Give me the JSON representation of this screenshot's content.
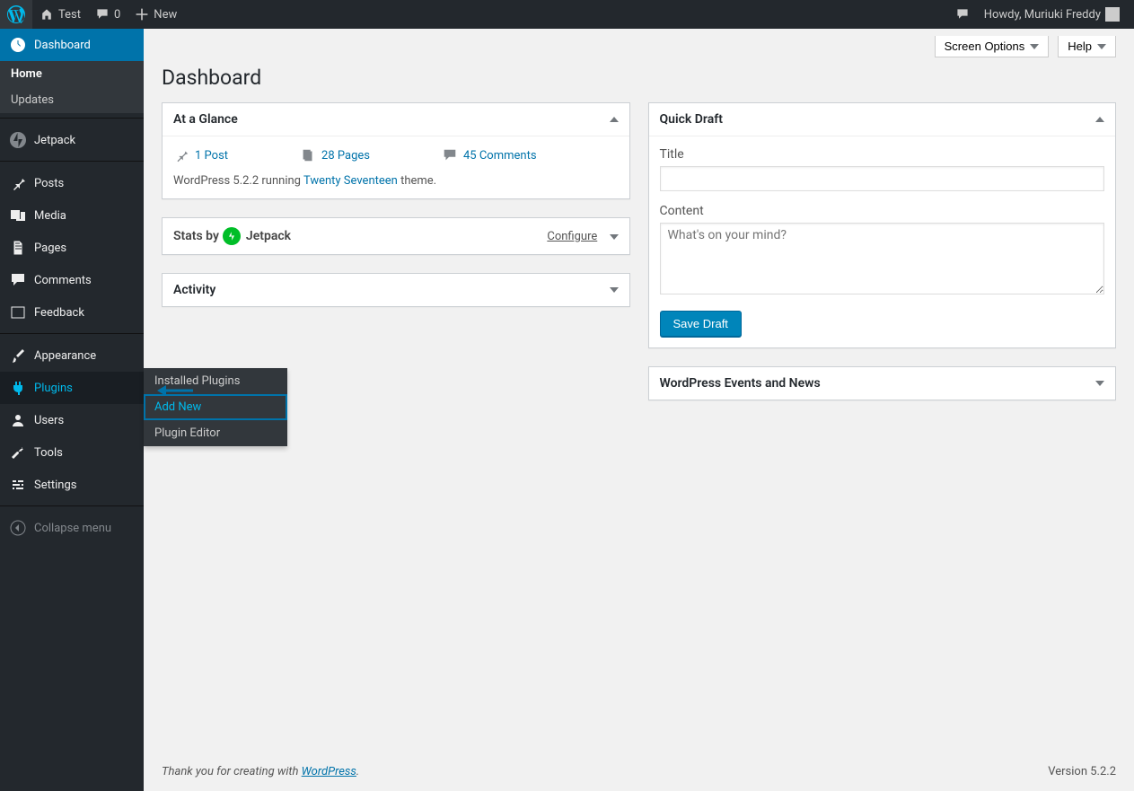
{
  "topbar": {
    "site_name": "Test",
    "comment_count": "0",
    "new_label": "New",
    "greeting": "Howdy, Muriuki Freddy"
  },
  "sidebar": {
    "dashboard": "Dashboard",
    "dashboard_sub": {
      "home": "Home",
      "updates": "Updates"
    },
    "jetpack": "Jetpack",
    "posts": "Posts",
    "media": "Media",
    "pages": "Pages",
    "comments": "Comments",
    "feedback": "Feedback",
    "appearance": "Appearance",
    "plugins": "Plugins",
    "plugins_fly": {
      "installed": "Installed Plugins",
      "add_new": "Add New",
      "editor": "Plugin Editor"
    },
    "users": "Users",
    "tools": "Tools",
    "settings": "Settings",
    "collapse": "Collapse menu"
  },
  "header": {
    "screen_options": "Screen Options",
    "help": "Help",
    "title": "Dashboard"
  },
  "glance": {
    "title": "At a Glance",
    "posts": "1 Post",
    "pages": "28 Pages",
    "comments": "45 Comments",
    "wp_version_prefix": "WordPress 5.2.2 running ",
    "theme": "Twenty Seventeen",
    "theme_suffix": " theme."
  },
  "stats": {
    "by": "Stats  by",
    "jetpack": "Jetpack",
    "configure": "Configure"
  },
  "activity": {
    "title": "Activity"
  },
  "quickdraft": {
    "title": "Quick Draft",
    "title_label": "Title",
    "content_label": "Content",
    "content_placeholder": "What's on your mind?",
    "save": "Save Draft"
  },
  "events": {
    "title": "WordPress Events and News"
  },
  "footer": {
    "thanks": "Thank you for creating with ",
    "wp": "WordPress",
    "version": "Version 5.2.2"
  }
}
